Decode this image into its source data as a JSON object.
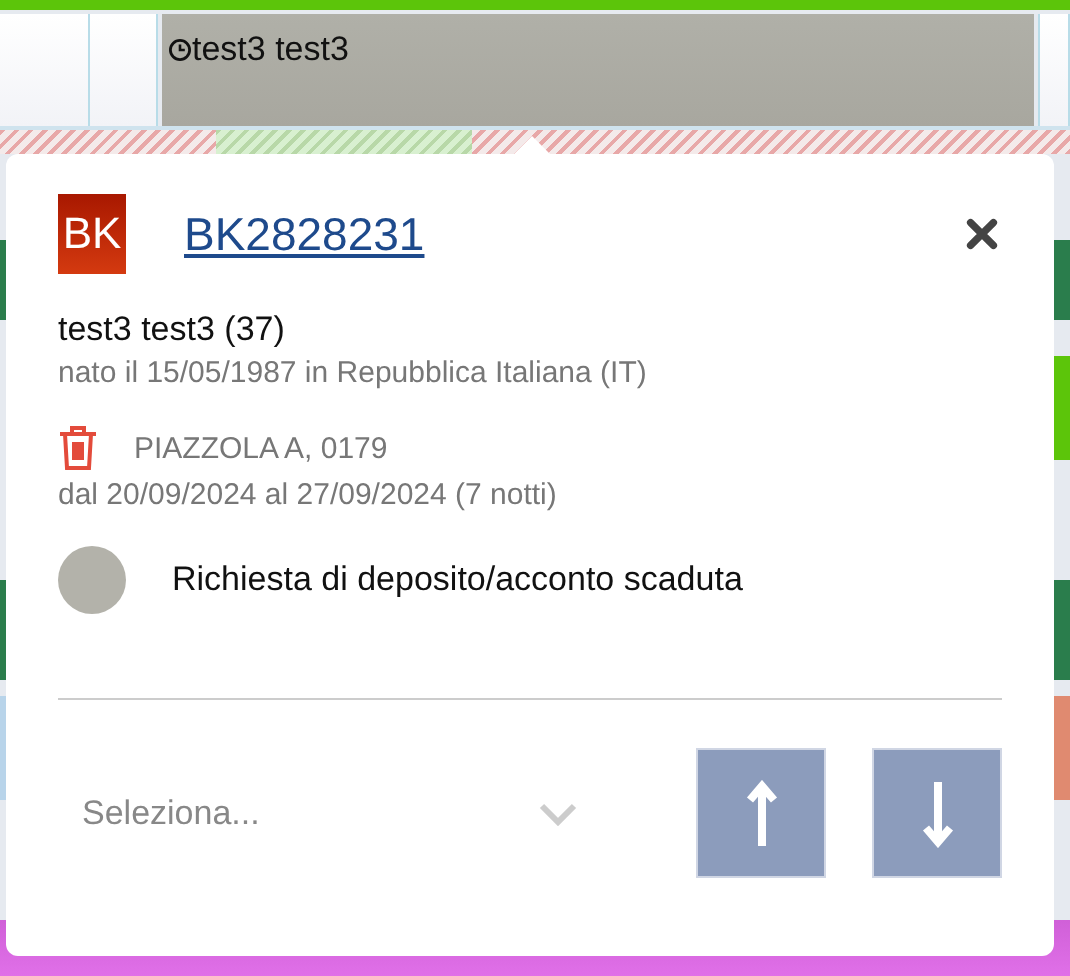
{
  "timeline": {
    "booking_title": "test3 test3"
  },
  "side_bars": [
    {
      "color": "#5cc50a"
    },
    {
      "color": "#e08a70"
    }
  ],
  "popup": {
    "logo": "BK",
    "booking_code": "BK2828231",
    "guest": "test3 test3 (37)",
    "birth": "nato il 15/05/1987 in Repubblica Italiana (IT)",
    "pitch": "PIAZZOLA A, 0179",
    "dates": "dal 20/09/2024 al 27/09/2024 (7 notti)",
    "status": {
      "label": "Richiesta di deposito/acconto scaduta",
      "color": "#b3b2aa"
    },
    "select": {
      "placeholder": "Seleziona..."
    }
  }
}
